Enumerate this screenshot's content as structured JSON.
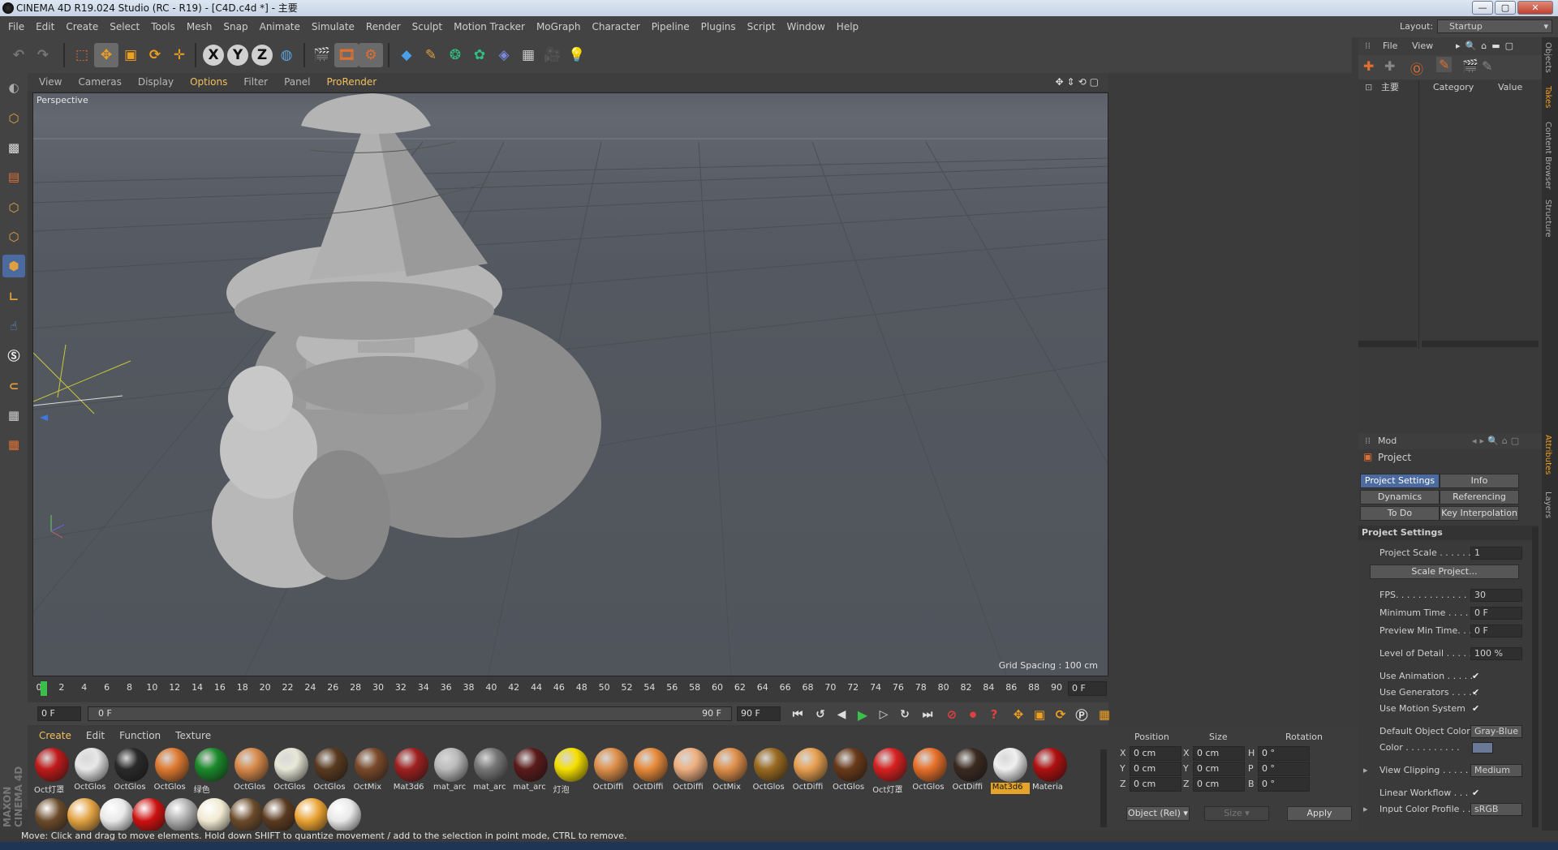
{
  "window": {
    "title": "CINEMA 4D R19.024 Studio (RC - R19) - [C4D.c4d *] - 主要",
    "min": "—",
    "max": "▢",
    "close": "✕"
  },
  "menu": [
    "File",
    "Edit",
    "Create",
    "Select",
    "Tools",
    "Mesh",
    "Snap",
    "Animate",
    "Simulate",
    "Render",
    "Sculpt",
    "Motion Tracker",
    "MoGraph",
    "Character",
    "Pipeline",
    "Plugins",
    "Script",
    "Window",
    "Help"
  ],
  "layout": {
    "label": "Layout:",
    "value": "Startup"
  },
  "toolbar": {
    "x": "X",
    "y": "Y",
    "z": "Z"
  },
  "viewport": {
    "menu": [
      "View",
      "Cameras",
      "Display",
      "Options",
      "Filter",
      "Panel",
      "ProRender"
    ],
    "label": "Perspective",
    "grid_spacing": "Grid Spacing : 100 cm"
  },
  "timeline": {
    "ticks": [
      "0",
      "2",
      "4",
      "6",
      "8",
      "10",
      "12",
      "14",
      "16",
      "18",
      "20",
      "22",
      "24",
      "26",
      "28",
      "30",
      "32",
      "34",
      "36",
      "38",
      "40",
      "42",
      "44",
      "46",
      "48",
      "50",
      "52",
      "54",
      "56",
      "58",
      "60",
      "62",
      "64",
      "66",
      "68",
      "70",
      "72",
      "74",
      "76",
      "78",
      "80",
      "82",
      "84",
      "86",
      "88",
      "90"
    ],
    "current": "0 F"
  },
  "transport": {
    "start": "0 F",
    "slider_start": "0 F",
    "slider_end": "90 F",
    "end": "90 F"
  },
  "materials": {
    "menu": [
      "Create",
      "Edit",
      "Function",
      "Texture"
    ],
    "items": [
      {
        "label": "Oct灯罩",
        "color": "#c01a1a"
      },
      {
        "label": "OctGlos",
        "color": "#e8e8e8"
      },
      {
        "label": "OctGlos",
        "color": "#2a2a2a"
      },
      {
        "label": "OctGlos",
        "color": "#e07a30"
      },
      {
        "label": "绿色",
        "color": "#1a8a2a"
      },
      {
        "label": "OctGlos",
        "color": "#d88a4a"
      },
      {
        "label": "OctGlos",
        "color": "#e8e8d8"
      },
      {
        "label": "OctGlos",
        "color": "#5a3a20"
      },
      {
        "label": "OctMix",
        "color": "#7a4a2a"
      },
      {
        "label": "Mat3d6",
        "color": "#a02020"
      },
      {
        "label": "mat_arc",
        "color": "#bbbbbb"
      },
      {
        "label": "mat_arc",
        "color": "#777777"
      },
      {
        "label": "mat_arc",
        "color": "#5a1a1a"
      },
      {
        "label": "灯泡",
        "color": "#f6e000"
      },
      {
        "label": "OctDiffi",
        "color": "#e0904a"
      },
      {
        "label": "OctDiffi",
        "color": "#e88a3a"
      },
      {
        "label": "OctDiffi",
        "color": "#f0b080"
      },
      {
        "label": "OctMix",
        "color": "#e0904a"
      },
      {
        "label": "OctGlos",
        "color": "#9a6a20"
      },
      {
        "label": "OctDiffi",
        "color": "#e8a050"
      },
      {
        "label": "OctGlos",
        "color": "#6a3a1a"
      },
      {
        "label": "Oct灯罩",
        "color": "#d82020"
      },
      {
        "label": "OctGlos",
        "color": "#e8702a"
      },
      {
        "label": "OctDiffi",
        "color": "#3a2a20"
      },
      {
        "label": "Mat3d6",
        "color": "#f0f0f0"
      },
      {
        "label": "Materia",
        "color": "#b01010"
      }
    ],
    "row2": [
      "#6a4a2a",
      "#e0a040",
      "#e8e8e8",
      "#cc1010",
      "#aaaaaa",
      "#f0e8d0",
      "#6a4a2a",
      "#5a3a20",
      "#e8a030",
      "#e8e8e8"
    ]
  },
  "coords": {
    "headers": [
      "Position",
      "Size",
      "Rotation"
    ],
    "rows": [
      [
        "X",
        "0 cm",
        "X",
        "0 cm",
        "H",
        "0 °"
      ],
      [
        "Y",
        "0 cm",
        "Y",
        "0 cm",
        "P",
        "0 °"
      ],
      [
        "Z",
        "0 cm",
        "Z",
        "0 cm",
        "B",
        "0 °"
      ]
    ],
    "mode": "Object (Rel)",
    "size_mode": "Size",
    "apply": "Apply"
  },
  "objects": {
    "menu": [
      "File",
      "View"
    ],
    "root": "主要",
    "col_category": "Category",
    "col_value": "Value"
  },
  "attributes": {
    "mode": "Mod",
    "title": "Project",
    "tabs": [
      "Project Settings",
      "Info",
      "Dynamics",
      "Referencing",
      "To Do",
      "Key Interpolation"
    ],
    "section": "Project Settings",
    "project_scale": {
      "label": "Project Scale . . . . . .",
      "value": "1"
    },
    "scale_button": "Scale Project...",
    "fps": {
      "label": "FPS. . . . . . . . . . . . . .",
      "value": "30"
    },
    "min_time": {
      "label": "Minimum Time . . . . .",
      "value": "0 F"
    },
    "prev_min": {
      "label": "Preview Min Time. . .",
      "value": "0 F"
    },
    "lod": {
      "label": "Level of Detail . . . . .",
      "value": "100 %"
    },
    "use_anim": "Use Animation . . . . .",
    "use_gen": "Use Generators . . . . .",
    "use_motion": "Use Motion System",
    "default_color": {
      "label": "Default Object Color",
      "value": "Gray-Blue"
    },
    "color": "Color . . . . . . . . . .",
    "view_clip": {
      "label": "View Clipping . . . . .",
      "value": "Medium"
    },
    "linear": "Linear Workflow . . .",
    "profile": {
      "label": "Input Color Profile . .",
      "value": "sRGB"
    },
    "check": "✔"
  },
  "right_tabs": [
    "Objects",
    "Takes",
    "Content Browser",
    "Structure"
  ],
  "right_tabs2": [
    "Attributes",
    "Layers"
  ],
  "status": "Move: Click and drag to move elements. Hold down SHIFT to quantize movement / add to the selection in point mode, CTRL to remove.",
  "brand": "MAXON CINEMA 4D"
}
